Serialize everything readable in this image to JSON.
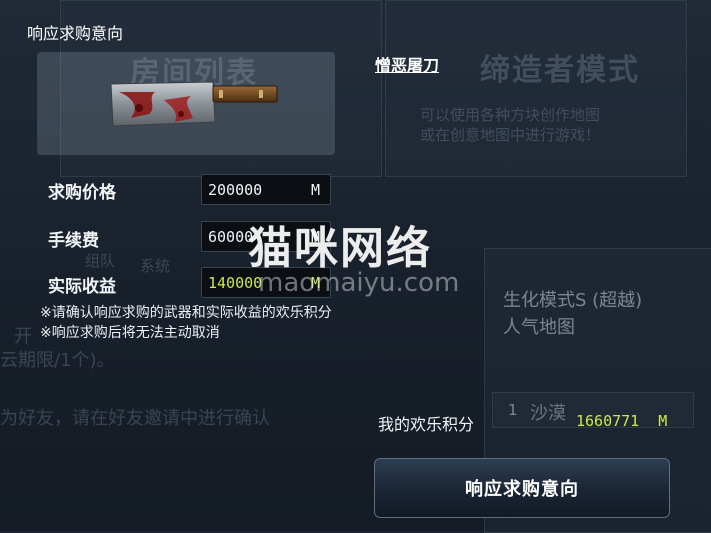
{
  "background": {
    "room_list": "房间列表",
    "creator_mode": "缔造者模式",
    "creator_desc_1": "可以使用各种方块创作地图",
    "creator_desc_2": "或在创意地图中进行游戏！",
    "tab_1": "组队",
    "tab_2": "系统",
    "open_text": "开",
    "period_text": "云期限/1个)。",
    "friend_text": "为好友，请在好友邀请中进行确认",
    "mode_name": "生化模式S (超越)",
    "mode_sub": "人气地图",
    "map_1": "沙漠",
    "map_1_icon": "1"
  },
  "dialog": {
    "title": "响应求购意向",
    "item_name": "憎恶屠刀",
    "item_icon": "cleaver-weapon-icon",
    "price_label": "求购价格",
    "price_value": "200000",
    "price_unit": "M",
    "fee_label": "手续费",
    "fee_value": "60000",
    "fee_unit": "M",
    "income_label": "实际收益",
    "income_value": "140000",
    "income_unit": "M",
    "note_1": "※请确认响应求购的武器和实际收益的欢乐积分",
    "note_2": "※响应求购后将无法主动取消",
    "balance_label": "我的欢乐积分",
    "balance_value": "1660771",
    "balance_unit": "M",
    "submit_label": "响应求购意向"
  },
  "watermark": {
    "text": "猫咪网络",
    "url": "maomaiyu.com"
  },
  "colors": {
    "accent_green": "#cde84a",
    "panel_bg": "#1b2430"
  }
}
